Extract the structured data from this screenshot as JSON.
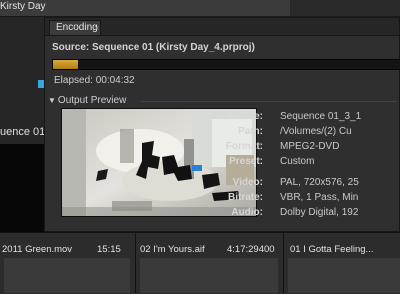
{
  "window": {
    "title": "Kirsty Day"
  },
  "background": {
    "sequence_label": "uence 01"
  },
  "panel": {
    "tab_label": "Encoding",
    "tab_close": "×",
    "source": "Source: Sequence 01 (Kirsty Day_4.prproj)",
    "progress": 0.07,
    "elapsed": "Elapsed: 00:04:32",
    "output_preview_label": "Output Preview"
  },
  "meta": [
    {
      "key": "File Name:",
      "value": "Sequence 01_3_1"
    },
    {
      "key": "Path:",
      "value": "/Volumes/(2) Cu"
    },
    {
      "key": "Format:",
      "value": "MPEG2-DVD"
    },
    {
      "key": "Preset:",
      "value": "Custom"
    },
    {
      "key": "Video:",
      "value": "PAL, 720x576, 25"
    },
    {
      "key": "Bitrate:",
      "value": "VBR, 1 Pass, Min"
    },
    {
      "key": "Audio:",
      "value": "Dolby Digital, 192"
    }
  ],
  "clips": [
    {
      "name": "2011 Green.mov",
      "duration": "15:15"
    },
    {
      "name": "02 I'm Yours.aif",
      "duration": "4:17:29400"
    },
    {
      "name": "01 I Gotta Feeling...",
      "duration": ""
    }
  ],
  "colors": {
    "progress_fill": "#d19a26",
    "selection_blue": "#35a8df"
  }
}
